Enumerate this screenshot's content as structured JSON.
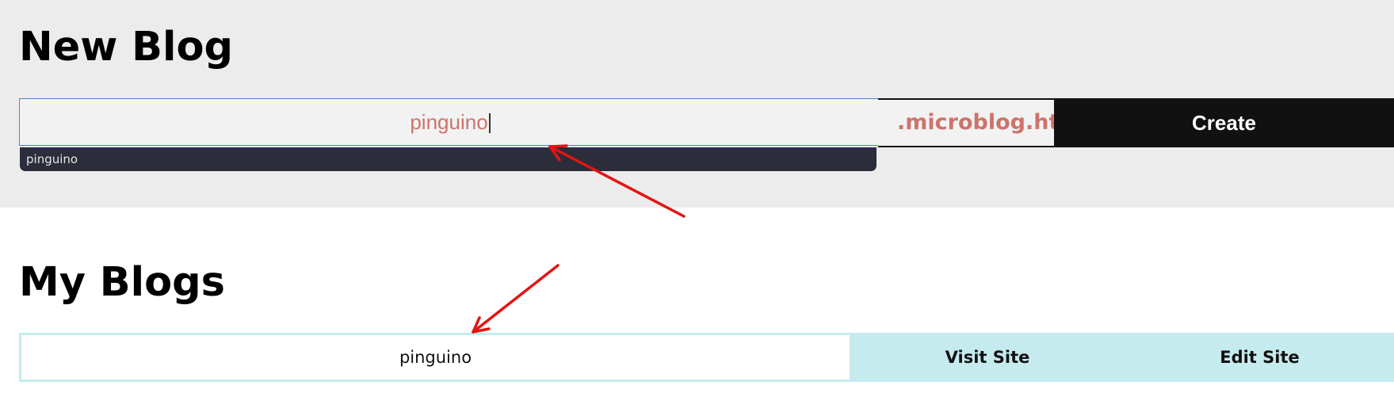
{
  "new_blog": {
    "heading": "New Blog",
    "input_value": "pinguino",
    "domain_suffix": ".microblog.htb",
    "create_label": "Create",
    "autocomplete_suggestion": "pinguino"
  },
  "my_blogs": {
    "heading": "My Blogs",
    "blogs": [
      {
        "name": "pinguino",
        "visit_label": "Visit Site",
        "edit_label": "Edit Site"
      }
    ]
  },
  "colors": {
    "annotation_arrow": "#e31414",
    "accent_text": "#cd736c",
    "button_dark": "#111111",
    "button_light": "#c5ebee",
    "autocomplete_bg": "#2b2d3b"
  },
  "icons": {
    "annotation": "red-arrow-icon"
  }
}
